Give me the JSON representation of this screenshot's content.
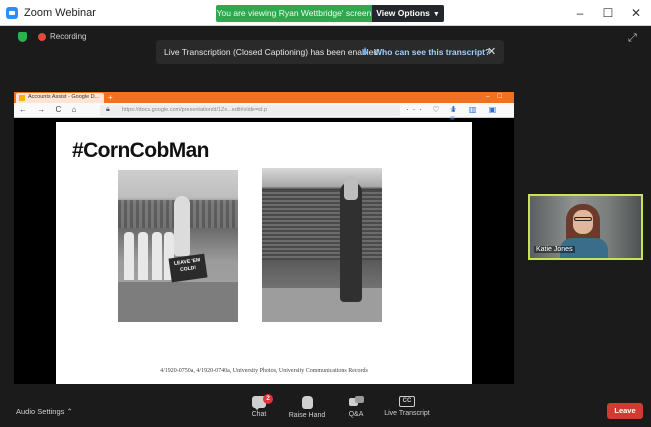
{
  "window": {
    "title": "Zoom Webinar",
    "viewing_banner": "You are viewing Ryan Wettbridge' screen",
    "view_options_label": "View Options",
    "minimize": "–",
    "maximize": "☐",
    "close": "✕"
  },
  "status": {
    "recording_label": "Recording"
  },
  "notice": {
    "message": "Live Transcription (Closed Captioning) has been enabled",
    "link_label": "Who can see this transcript?",
    "dismiss": "✕"
  },
  "browser": {
    "tab_title": "Accounts Assist - Google D...",
    "new_tab": "+",
    "window_ctrls": "– ☐ ✕",
    "nav": "← → C ⌂",
    "url": "https://docs.google.com/presentation/d/1Zx...edit#slide=id.p",
    "url_tail": "··· ♡ ☆",
    "tool_icons": "⬇ ▥ ▣ ≡"
  },
  "slide": {
    "title": "#CornCobMan",
    "sign_text": "LEAVE 'EM COLD!",
    "caption": "4/1920-0750a, 4/1920-0740a, University Photos, University Communications Records"
  },
  "participant": {
    "name": "Katie Jones"
  },
  "controls": {
    "audio_settings_label": "Audio Settings",
    "chat_label": "Chat",
    "chat_badge": "2",
    "raise_hand_label": "Raise Hand",
    "qa_label": "Q&A",
    "live_transcript_label": "Live Transcript",
    "cc_text": "CC",
    "leave_label": "Leave"
  },
  "colors": {
    "banner_green": "#2fa84f",
    "browser_orange": "#f37021",
    "speaker_highlight": "#c9e25a",
    "leave_red": "#d23b2f",
    "badge_red": "#e0323a"
  }
}
